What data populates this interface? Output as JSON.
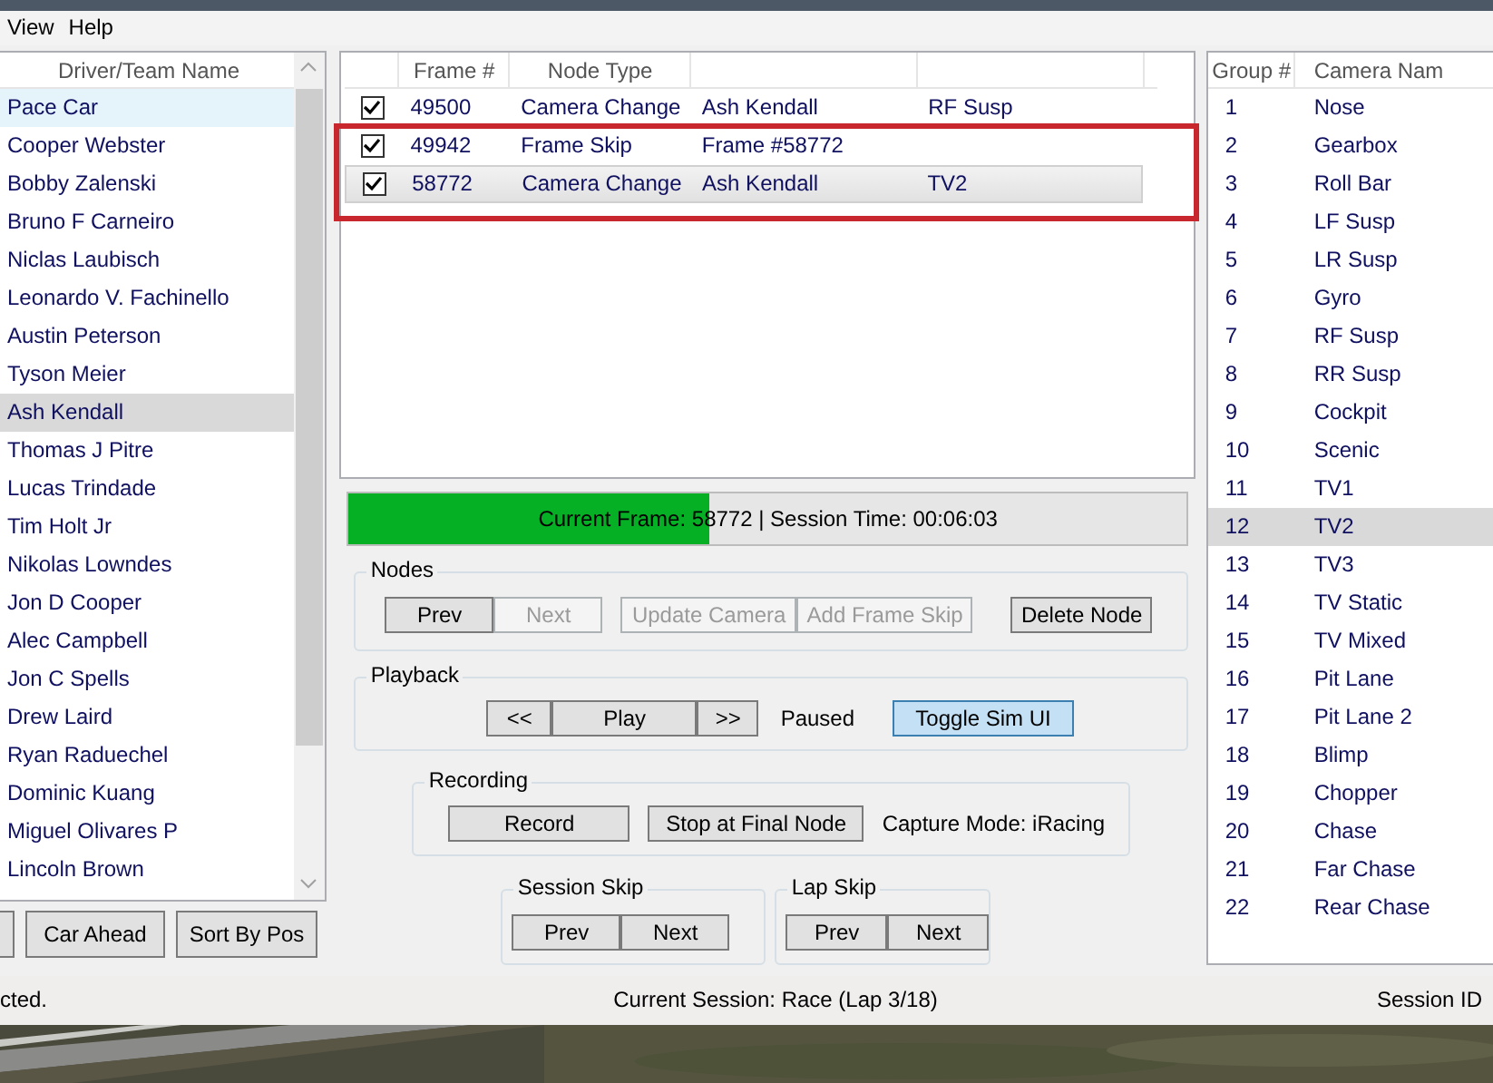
{
  "menu": [
    "View",
    "Help"
  ],
  "drivers": {
    "heading": "Driver/Team Name",
    "items": [
      {
        "name": "Pace Car",
        "selected": false,
        "hovered": true
      },
      {
        "name": "Cooper Webster",
        "selected": false,
        "hovered": false
      },
      {
        "name": "Bobby Zalenski",
        "selected": false,
        "hovered": false
      },
      {
        "name": "Bruno F Carneiro",
        "selected": false,
        "hovered": false
      },
      {
        "name": "Niclas Laubisch",
        "selected": false,
        "hovered": false
      },
      {
        "name": "Leonardo V. Fachinello",
        "selected": false,
        "hovered": false
      },
      {
        "name": "Austin Peterson",
        "selected": false,
        "hovered": false
      },
      {
        "name": "Tyson Meier",
        "selected": false,
        "hovered": false
      },
      {
        "name": "Ash Kendall",
        "selected": true,
        "hovered": false
      },
      {
        "name": "Thomas J Pitre",
        "selected": false,
        "hovered": false
      },
      {
        "name": "Lucas Trindade",
        "selected": false,
        "hovered": false
      },
      {
        "name": "Tim Holt Jr",
        "selected": false,
        "hovered": false
      },
      {
        "name": "Nikolas Lowndes",
        "selected": false,
        "hovered": false
      },
      {
        "name": "Jon D Cooper",
        "selected": false,
        "hovered": false
      },
      {
        "name": "Alec Campbell",
        "selected": false,
        "hovered": false
      },
      {
        "name": "Jon C Spells",
        "selected": false,
        "hovered": false
      },
      {
        "name": "Drew Laird",
        "selected": false,
        "hovered": false
      },
      {
        "name": "Ryan Raduechel",
        "selected": false,
        "hovered": false
      },
      {
        "name": "Dominic Kuang",
        "selected": false,
        "hovered": false
      },
      {
        "name": "Miguel Olivares P",
        "selected": false,
        "hovered": false
      },
      {
        "name": "Lincoln Brown",
        "selected": false,
        "hovered": false
      }
    ]
  },
  "driver_buttons": [
    "Car Ahead",
    "Sort By Pos"
  ],
  "nodes_table": {
    "columns": [
      "Frame #",
      "Node Type"
    ],
    "rows": [
      {
        "checked": true,
        "selected": false,
        "highlighted": false,
        "cells": [
          "49500",
          "Camera Change",
          "Ash Kendall",
          "RF Susp"
        ]
      },
      {
        "checked": true,
        "selected": false,
        "highlighted": true,
        "cells": [
          "49942",
          "Frame Skip",
          "Frame #58772",
          ""
        ]
      },
      {
        "checked": true,
        "selected": true,
        "highlighted": true,
        "cells": [
          "58772",
          "Camera Change",
          "Ash Kendall",
          "TV2"
        ]
      }
    ]
  },
  "progress": {
    "level": 0.43,
    "text": "Current Frame: 58772 | Session Time: 00:06:03"
  },
  "nodes": {
    "title": "Nodes",
    "buttons": [
      {
        "label": "Prev",
        "disabled": false
      },
      {
        "label": "Next",
        "disabled": true
      },
      {
        "label": "Update Camera",
        "disabled": true
      },
      {
        "label": "Add Frame Skip",
        "disabled": true
      },
      {
        "label": "Delete Node",
        "disabled": false
      }
    ]
  },
  "playback": {
    "title": "Playback",
    "buttons": [
      "<<",
      "Play",
      ">>"
    ],
    "state": "Paused",
    "toggle": {
      "label": "Toggle Sim UI",
      "focused": true
    }
  },
  "recording": {
    "title": "Recording",
    "buttons": [
      "Record",
      "Stop at Final Node"
    ],
    "capture_mode": "Capture Mode: iRacing"
  },
  "session_skip": {
    "title": "Session Skip",
    "buttons": [
      "Prev",
      "Next"
    ]
  },
  "lap_skip": {
    "title": "Lap Skip",
    "buttons": [
      "Prev",
      "Next"
    ]
  },
  "cameras": {
    "columns": [
      "Group #",
      "Camera Nam"
    ],
    "rows": [
      {
        "num": "1",
        "name": "Nose",
        "selected": false
      },
      {
        "num": "2",
        "name": "Gearbox",
        "selected": false
      },
      {
        "num": "3",
        "name": "Roll Bar",
        "selected": false
      },
      {
        "num": "4",
        "name": "LF Susp",
        "selected": false
      },
      {
        "num": "5",
        "name": "LR Susp",
        "selected": false
      },
      {
        "num": "6",
        "name": "Gyro",
        "selected": false
      },
      {
        "num": "7",
        "name": "RF Susp",
        "selected": false
      },
      {
        "num": "8",
        "name": "RR Susp",
        "selected": false
      },
      {
        "num": "9",
        "name": "Cockpit",
        "selected": false
      },
      {
        "num": "10",
        "name": "Scenic",
        "selected": false
      },
      {
        "num": "11",
        "name": "TV1",
        "selected": false
      },
      {
        "num": "12",
        "name": "TV2",
        "selected": true
      },
      {
        "num": "13",
        "name": "TV3",
        "selected": false
      },
      {
        "num": "14",
        "name": "TV Static",
        "selected": false
      },
      {
        "num": "15",
        "name": "TV Mixed",
        "selected": false
      },
      {
        "num": "16",
        "name": "Pit Lane",
        "selected": false
      },
      {
        "num": "17",
        "name": "Pit Lane 2",
        "selected": false
      },
      {
        "num": "18",
        "name": "Blimp",
        "selected": false
      },
      {
        "num": "19",
        "name": "Chopper",
        "selected": false
      },
      {
        "num": "20",
        "name": "Chase",
        "selected": false
      },
      {
        "num": "21",
        "name": "Far Chase",
        "selected": false
      },
      {
        "num": "22",
        "name": "Rear Chase",
        "selected": false
      }
    ]
  },
  "status_bar": [
    "cted.",
    "Current Session: Race (Lap 3/18)",
    "Session ID"
  ],
  "background": {
    "kind": "picture"
  }
}
